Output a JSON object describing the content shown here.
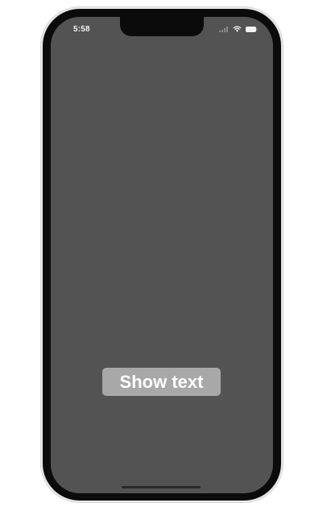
{
  "status_bar": {
    "time": "5:58",
    "icons": [
      "signal-icon",
      "wifi-icon",
      "battery-icon"
    ]
  },
  "main": {
    "button_label": "Show text"
  },
  "colors": {
    "screen_background": "#535353",
    "button_background": "#a8a8a8",
    "button_text": "#ffffff",
    "phone_frame": "#0b0b0b"
  }
}
